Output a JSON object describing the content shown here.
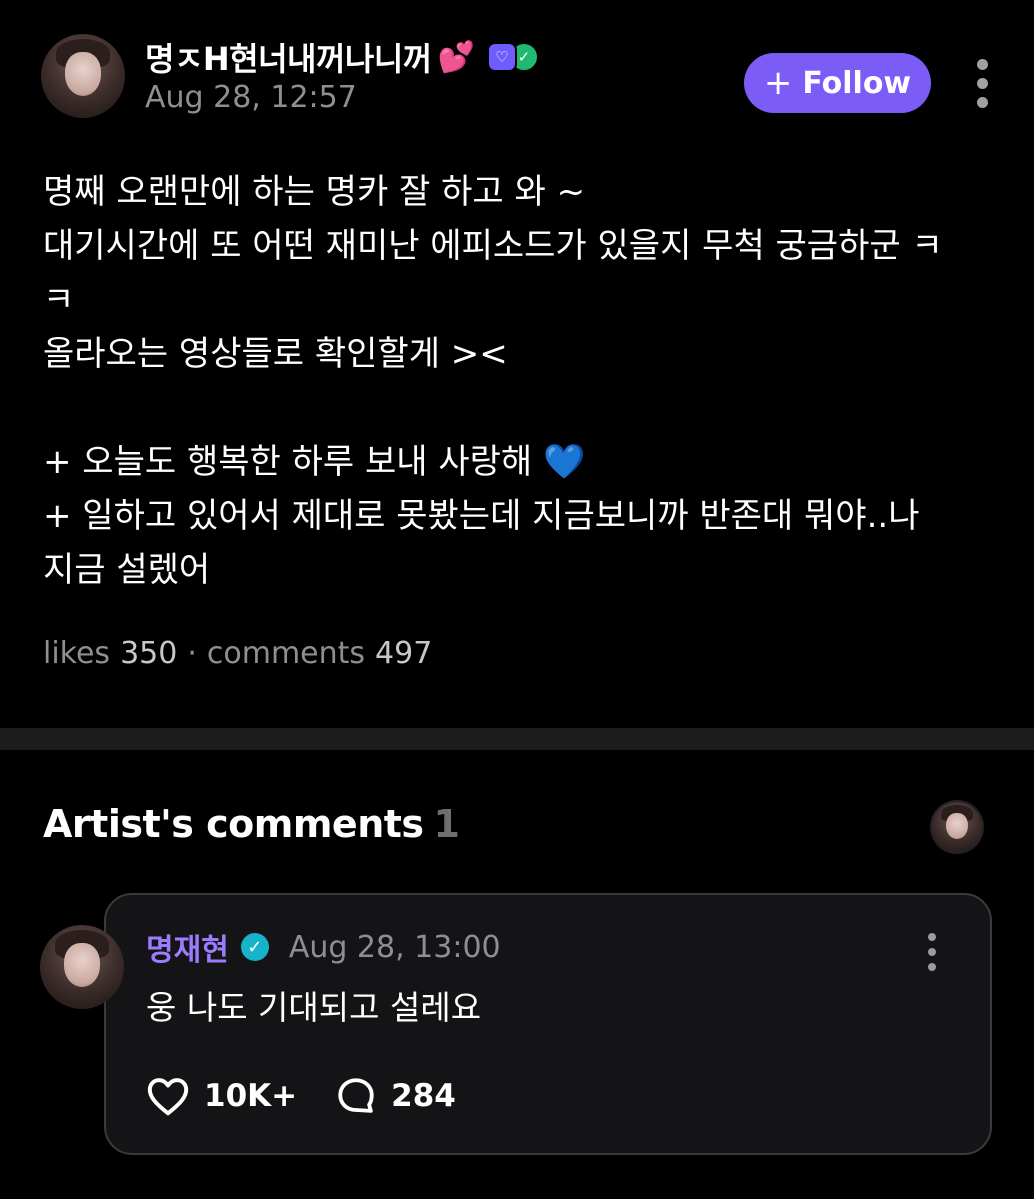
{
  "post": {
    "author": {
      "name": "명ㅈH현너내꺼나니꺼",
      "emoji": "💕",
      "timestamp": "Aug 28, 12:57"
    },
    "follow_label": "Follow",
    "follow_icon": "+",
    "body_lines": [
      "명째 오랜만에 하는 명카 잘 하고 와 ~",
      "대기시간에 또 어떤 재미난 에피소드가 있을지 무척 궁금하군 ㅋ",
      "ㅋ",
      "올라오는 영상들로 확인할게 ><",
      "",
      "+ 오늘도 행복한 하루 보내 사랑해 💙",
      "+ 일하고 있어서 제대로 못봤는데 지금보니까 반존대 뭐야..나",
      "지금 설렜어"
    ],
    "stats": {
      "likes_label": "likes",
      "likes_count": "350",
      "separator": "·",
      "comments_label": "comments",
      "comments_count": "497"
    }
  },
  "artist_comments": {
    "title": "Artist's comments",
    "count": "1",
    "comment": {
      "author": "명재현",
      "verified_icon": "✓",
      "timestamp": "Aug 28, 13:00",
      "text": "웅 나도 기대되고 설레요",
      "likes": "10K+",
      "replies": "284"
    }
  },
  "colors": {
    "background": "#000000",
    "accent": "#7c5cf6",
    "artist_name": "#9b7cff",
    "verified": "#17b3c9",
    "muted_text": "#8e8e93"
  }
}
